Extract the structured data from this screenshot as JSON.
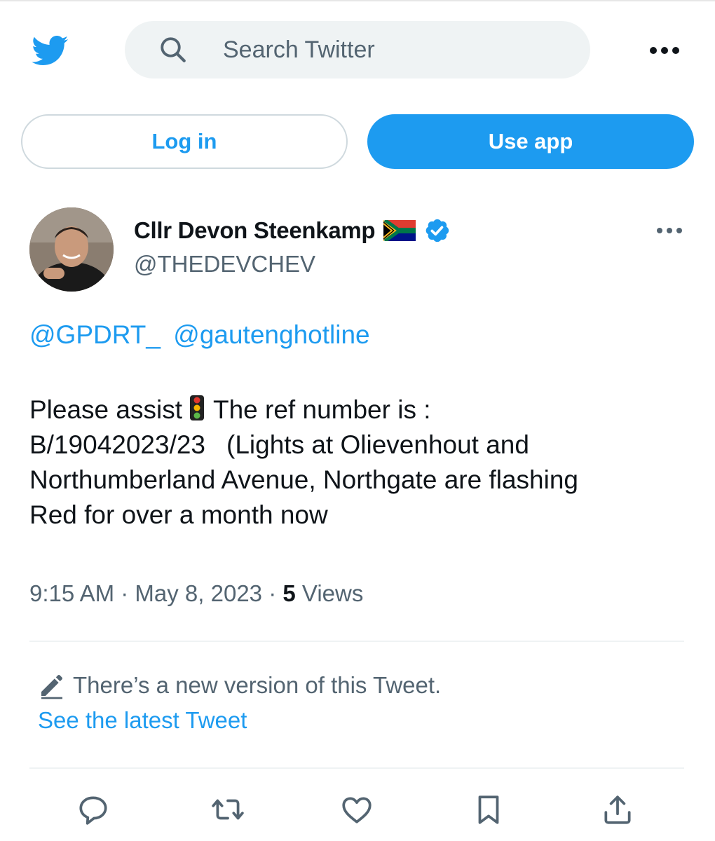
{
  "header": {
    "logo_icon": "twitter-bird-icon",
    "search_placeholder": "Search Twitter",
    "more_icon": "more-dots-icon"
  },
  "auth": {
    "login_label": "Log in",
    "use_app_label": "Use app"
  },
  "tweet": {
    "author_name": "Cllr Devon Steenkamp",
    "author_handle": "@THEDEVCHEV",
    "flag_icon": "south-africa-flag-icon",
    "verified_icon": "verified-badge-icon",
    "mentions": [
      "@GPDRT_",
      "@gautenghotline"
    ],
    "body": {
      "line1_a": "Please assist",
      "line1_b": "The ref number is :",
      "line2_a": "B/19042023/23",
      "line2_b": "(Lights at Olievenhout and",
      "line3": "Northumberland Avenue, Northgate are flashing",
      "line4": "Red for over a month now"
    },
    "emoji_icon": "traffic-light-icon",
    "time": "9:15 AM",
    "separator": "·",
    "date": "May 8, 2023",
    "views_count": "5",
    "views_label": "Views",
    "edit_notice": "There’s a new version of this Tweet.",
    "see_latest": "See the latest Tweet"
  },
  "actions": [
    "reply-icon",
    "retweet-icon",
    "like-icon",
    "bookmark-icon",
    "share-icon"
  ],
  "colors": {
    "accent": "#1d9bf0",
    "text": "#0f1419",
    "secondary": "#536471",
    "search_bg": "#eff3f4"
  }
}
